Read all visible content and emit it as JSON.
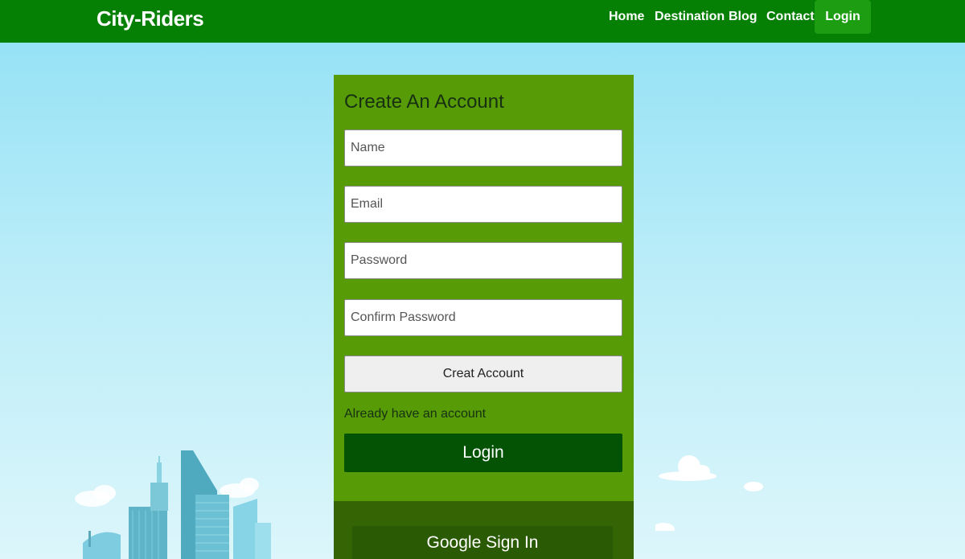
{
  "navbar": {
    "brand": "City-Riders",
    "links": [
      "Home",
      "Destination",
      "Blog",
      "Contact"
    ],
    "login": "Login"
  },
  "form": {
    "title": "Create An Account",
    "fields": {
      "name_placeholder": "Name",
      "email_placeholder": "Email",
      "password_placeholder": "Password",
      "confirm_placeholder": "Confirm Password"
    },
    "create_button": "Creat Account",
    "already_text": "Already have an account",
    "login_button": "Login",
    "google_button": "Google Sign In"
  },
  "colors": {
    "navbar": "#058005",
    "card": "#579b06",
    "login_button": "#045304",
    "card_bottom": "#356405"
  },
  "decor": [
    "city-skyline-illustration",
    "clouds-illustration"
  ]
}
